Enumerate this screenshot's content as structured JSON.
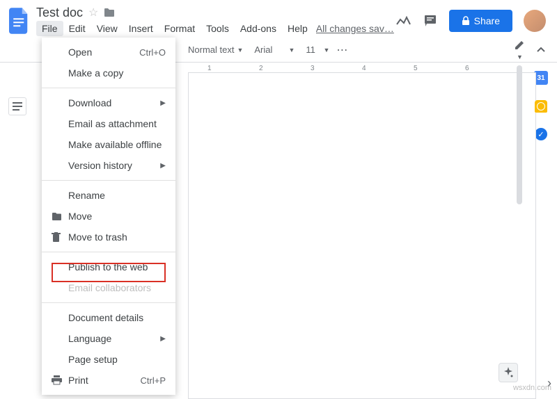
{
  "doc": {
    "title": "Test doc"
  },
  "menubar": {
    "file": "File",
    "edit": "Edit",
    "view": "View",
    "insert": "Insert",
    "format": "Format",
    "tools": "Tools",
    "addons": "Add-ons",
    "help": "Help",
    "save_status": "All changes sav…"
  },
  "toolbar": {
    "style": "Normal text",
    "font": "Arial",
    "size": "11"
  },
  "share": {
    "label": "Share"
  },
  "file_menu": {
    "open": "Open",
    "open_shortcut": "Ctrl+O",
    "make_copy": "Make a copy",
    "download": "Download",
    "email_attachment": "Email as attachment",
    "offline": "Make available offline",
    "version_history": "Version history",
    "rename": "Rename",
    "move": "Move",
    "trash": "Move to trash",
    "publish": "Publish to the web",
    "email_collab": "Email collaborators",
    "doc_details": "Document details",
    "language": "Language",
    "page_setup": "Page setup",
    "print": "Print",
    "print_shortcut": "Ctrl+P"
  },
  "ruler": {
    "t1": "1",
    "t2": "2",
    "t3": "3",
    "t4": "4",
    "t5": "5",
    "t6": "6"
  },
  "sidebar": {
    "cal_day": "31"
  },
  "watermark": "wsxdn.com"
}
